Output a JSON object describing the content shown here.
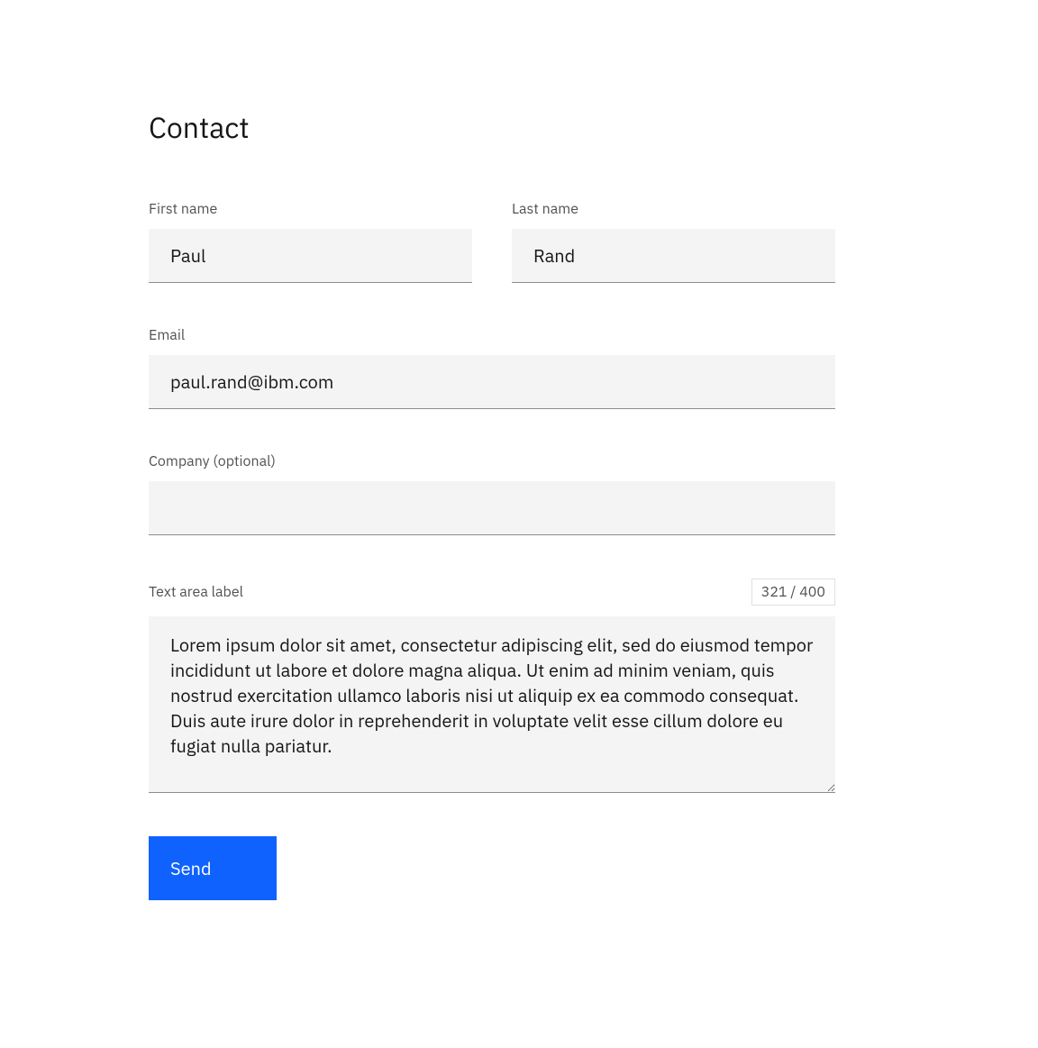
{
  "title": "Contact",
  "fields": {
    "first_name": {
      "label": "First name",
      "value": "Paul"
    },
    "last_name": {
      "label": "Last name",
      "value": "Rand"
    },
    "email": {
      "label": "Email",
      "value": "paul.rand@ibm.com"
    },
    "company": {
      "label": "Company (optional)",
      "value": ""
    },
    "message": {
      "label": "Text area label",
      "counter": "321 / 400",
      "value": "Lorem ipsum dolor sit amet, consectetur adipiscing elit, sed do eiusmod tempor incididunt ut labore et dolore magna aliqua. Ut enim ad minim veniam, quis nostrud exercitation ullamco laboris nisi ut aliquip ex ea commodo consequat. Duis aute irure dolor in reprehenderit in voluptate velit esse cillum dolore eu fugiat nulla pariatur."
    }
  },
  "buttons": {
    "send": "Send"
  }
}
